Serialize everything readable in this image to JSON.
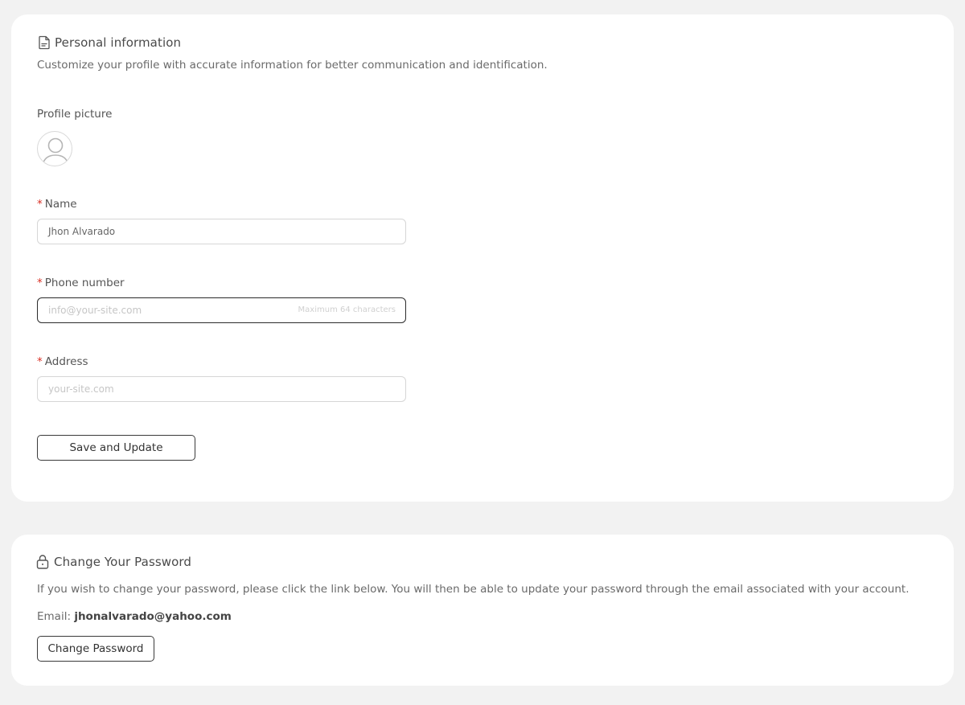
{
  "personal": {
    "title": "Personal information",
    "icon": "document-icon",
    "description": "Customize your profile with accurate information for better communication and identification.",
    "profile_picture_label": "Profile picture",
    "avatar_icon": "user-avatar-icon",
    "required_mark": "*",
    "name": {
      "label": "Name",
      "value": "Jhon Alvarado"
    },
    "phone": {
      "label": "Phone number",
      "placeholder": "info@your-site.com",
      "hint": "Maximum 64 characters"
    },
    "address": {
      "label": "Address",
      "placeholder": "your-site.com"
    },
    "save_button": "Save and Update"
  },
  "password": {
    "title": "Change Your Password",
    "icon": "lock-icon",
    "description": "If you wish to change your password, please click the link below. You will then be able to update your password through the email associated with your account.",
    "email_label": "Email:",
    "email_value": "jhonalvarado@yahoo.com",
    "button": "Change Password"
  },
  "colors": {
    "background": "#f2f2f2",
    "card": "#ffffff",
    "required": "#d93025",
    "focused_border": "#2b2b2b"
  }
}
